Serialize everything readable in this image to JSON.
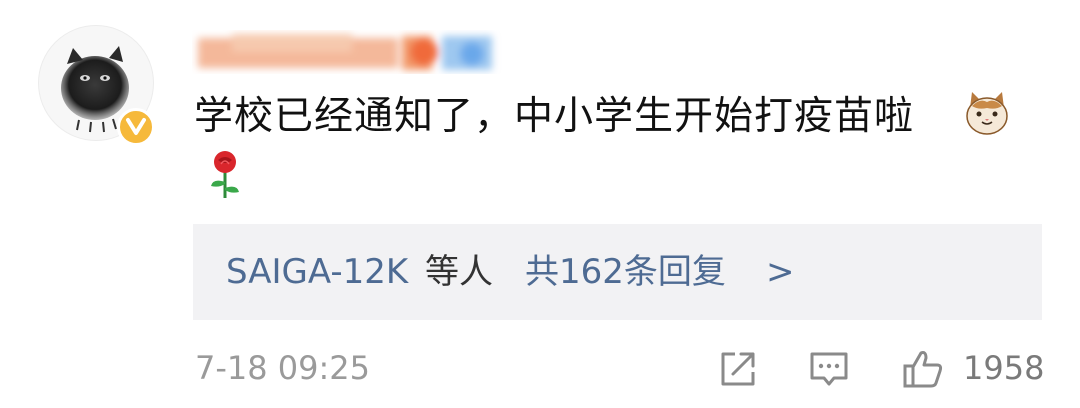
{
  "comment": {
    "text": "学校已经通知了，中小学生开始打疫苗啦",
    "emojis": [
      "cat-face-emoji",
      "rose-emoji"
    ]
  },
  "replies": {
    "users": "SAIGA-12K",
    "users_suffix": "等人",
    "count_text": "共162条回复",
    "chevron": ">"
  },
  "footer": {
    "timestamp": "7-18 09:25",
    "like_count": "1958",
    "icons": [
      "share-icon",
      "comment-icon",
      "like-icon"
    ]
  },
  "colors": {
    "link": "#4e6b93",
    "reply_bg": "#f2f2f4",
    "verified_badge": "#f6b93b",
    "meta_text": "#9a9a9a"
  }
}
